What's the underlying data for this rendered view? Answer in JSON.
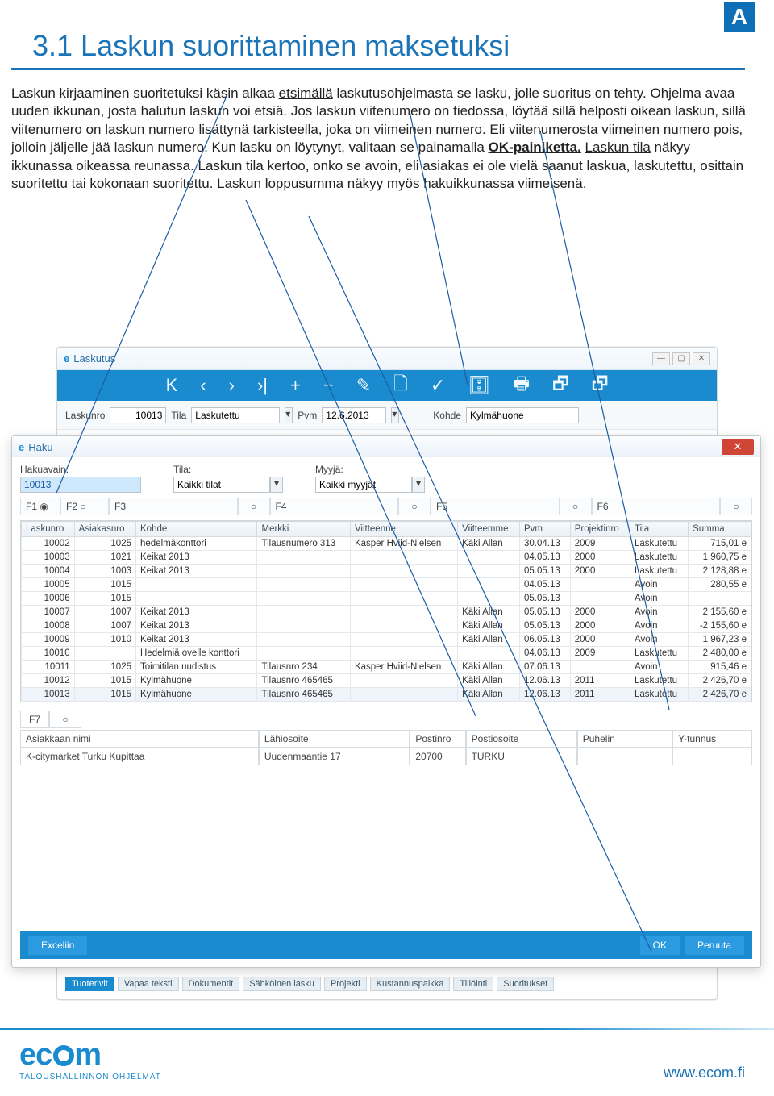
{
  "badge": "A",
  "page_title": "3.1 Laskun suorittaminen maksetuksi",
  "paragraph_parts": {
    "p1a": "Laskun kirjaaminen suoritetuksi käsin alkaa ",
    "p1_u1": "etsimällä",
    "p1b": " laskutusohjelmasta se lasku, jolle suoritus on tehty. Ohjelma avaa uuden ikkunan, josta halutun laskun voi etsiä. Jos laskun viitenumero on tiedossa, löytää sillä helposti oikean laskun, sillä viitenumero on laskun numero lisättynä tarkisteella, joka on viimeinen numero. Eli viitenumerosta viimeinen numero pois, jolloin jäljelle jää laskun numero. Kun lasku on löytynyt, valitaan se painamalla ",
    "p1_b1": "OK-painiketta.",
    "p1c": " ",
    "p1_u2": "Laskun tila",
    "p1d": " näkyy ikkunassa oikeassa reunassa. Laskun tila kertoo, onko se avoin, eli asiakas ei ole vielä saanut laskua, laskutettu, osittain suoritettu tai kokonaan suoritettu. Laskun loppusumma näkyy myös hakuikkunassa viimeisenä."
  },
  "laskutus": {
    "title": "Laskutus",
    "icon_letter": "e",
    "toolbar_glyphs": [
      "K",
      "‹",
      "›",
      "›|",
      "+",
      "−",
      "✎",
      "🗋",
      "✓",
      "🗄",
      "🖶",
      "🗗",
      "🗗"
    ],
    "labels": {
      "laskunro": "Laskunro",
      "tila": "Tila",
      "pvm": "Pvm",
      "kohde": "Kohde"
    },
    "values": {
      "laskunro": "10013",
      "tila": "Laskutettu",
      "pvm": "12.6.2013",
      "kohde": "Kylmähuone"
    },
    "tabs": [
      "Tuoterivit",
      "Vapaa teksti",
      "Dokumentit",
      "Sähköinen lasku",
      "Projekti",
      "Kustannuspaikka",
      "Tiliöinti",
      "Suoritukset"
    ]
  },
  "haku": {
    "title": "Haku",
    "icon_letter": "e",
    "labels": {
      "hakuavain": "Hakuavain:",
      "tila": "Tila:",
      "myyja": "Myyjä:"
    },
    "values": {
      "hakuavain": "10013",
      "tila": "Kaikki tilat",
      "myyja": "Kaikki myyjät"
    },
    "f_headers": [
      "F1",
      "F2",
      "F3",
      "F4",
      "F5",
      "F6"
    ],
    "columns": [
      "Laskunro",
      "Asiakasnro",
      "Kohde",
      "Merkki",
      "Viitteenne",
      "Viitteemme",
      "Pvm",
      "Projektinro",
      "Tila",
      "Summa"
    ],
    "rows": [
      {
        "l": "10002",
        "a": "1025",
        "k": "hedelmäkonttori",
        "m": "Tilausnumero 313",
        "vt": "Kasper Hviid-Nielsen",
        "vm": "Käki Allan",
        "p": "30.04.13",
        "pr": "2009",
        "t": "Laskutettu",
        "s": "715,01 e"
      },
      {
        "l": "10003",
        "a": "1021",
        "k": "Keikat 2013",
        "m": "",
        "vt": "",
        "vm": "",
        "p": "04.05.13",
        "pr": "2000",
        "t": "Laskutettu",
        "s": "1 960,75 e"
      },
      {
        "l": "10004",
        "a": "1003",
        "k": "Keikat 2013",
        "m": "",
        "vt": "",
        "vm": "",
        "p": "05.05.13",
        "pr": "2000",
        "t": "Laskutettu",
        "s": "2 128,88 e"
      },
      {
        "l": "10005",
        "a": "1015",
        "k": "",
        "m": "",
        "vt": "",
        "vm": "",
        "p": "04.05.13",
        "pr": "",
        "t": "Avoin",
        "s": "280,55 e"
      },
      {
        "l": "10006",
        "a": "1015",
        "k": "",
        "m": "",
        "vt": "",
        "vm": "",
        "p": "05.05.13",
        "pr": "",
        "t": "Avoin",
        "s": ""
      },
      {
        "l": "10007",
        "a": "1007",
        "k": "Keikat 2013",
        "m": "",
        "vt": "",
        "vm": "Käki Allan",
        "p": "05.05.13",
        "pr": "2000",
        "t": "Avoin",
        "s": "2 155,60 e"
      },
      {
        "l": "10008",
        "a": "1007",
        "k": "Keikat 2013",
        "m": "",
        "vt": "",
        "vm": "Käki Allan",
        "p": "05.05.13",
        "pr": "2000",
        "t": "Avoin",
        "s": "-2 155,60 e"
      },
      {
        "l": "10009",
        "a": "1010",
        "k": "Keikat 2013",
        "m": "",
        "vt": "",
        "vm": "Käki Allan",
        "p": "06.05.13",
        "pr": "2000",
        "t": "Avoin",
        "s": "1 967,23 e"
      },
      {
        "l": "10010",
        "a": "",
        "k": "Hedelmiä ovelle konttori",
        "m": "",
        "vt": "",
        "vm": "",
        "p": "04.06.13",
        "pr": "2009",
        "t": "Laskutettu",
        "s": "2 480,00 e"
      },
      {
        "l": "10011",
        "a": "1025",
        "k": "Toimitilan uudistus",
        "m": "Tilausnro 234",
        "vt": "Kasper Hviid-Nielsen",
        "vm": "Käki Allan",
        "p": "07.06.13",
        "pr": "",
        "t": "Avoin",
        "s": "915,46 e"
      },
      {
        "l": "10012",
        "a": "1015",
        "k": "Kylmähuone",
        "m": "Tilausnro 465465",
        "vt": "",
        "vm": "Käki Allan",
        "p": "12.06.13",
        "pr": "2011",
        "t": "Laskutettu",
        "s": "2 426,70 e"
      },
      {
        "l": "10013",
        "a": "1015",
        "k": "Kylmähuone",
        "m": "Tilausnro 465465",
        "vt": "",
        "vm": "Käki Allan",
        "p": "12.06.13",
        "pr": "2011",
        "t": "Laskutettu",
        "s": "2 426,70 e"
      }
    ],
    "f7_label": "F7",
    "f7_headers": [
      "Asiakkaan nimi",
      "Lähiosoite",
      "Postinro",
      "Postiosoite",
      "Puhelin",
      "Y-tunnus"
    ],
    "f7_values": [
      "K-citymarket Turku Kupittaa",
      "Uudenmaantie 17",
      "20700",
      "TURKU",
      "",
      ""
    ],
    "buttons": {
      "excel": "Exceliin",
      "ok": "OK",
      "cancel": "Peruuta"
    }
  },
  "footer": {
    "logo_text": "ec",
    "logo_text2": "m",
    "tagline": "TALOUSHALLINNON OHJELMAT",
    "url": "www.ecom.fi"
  }
}
